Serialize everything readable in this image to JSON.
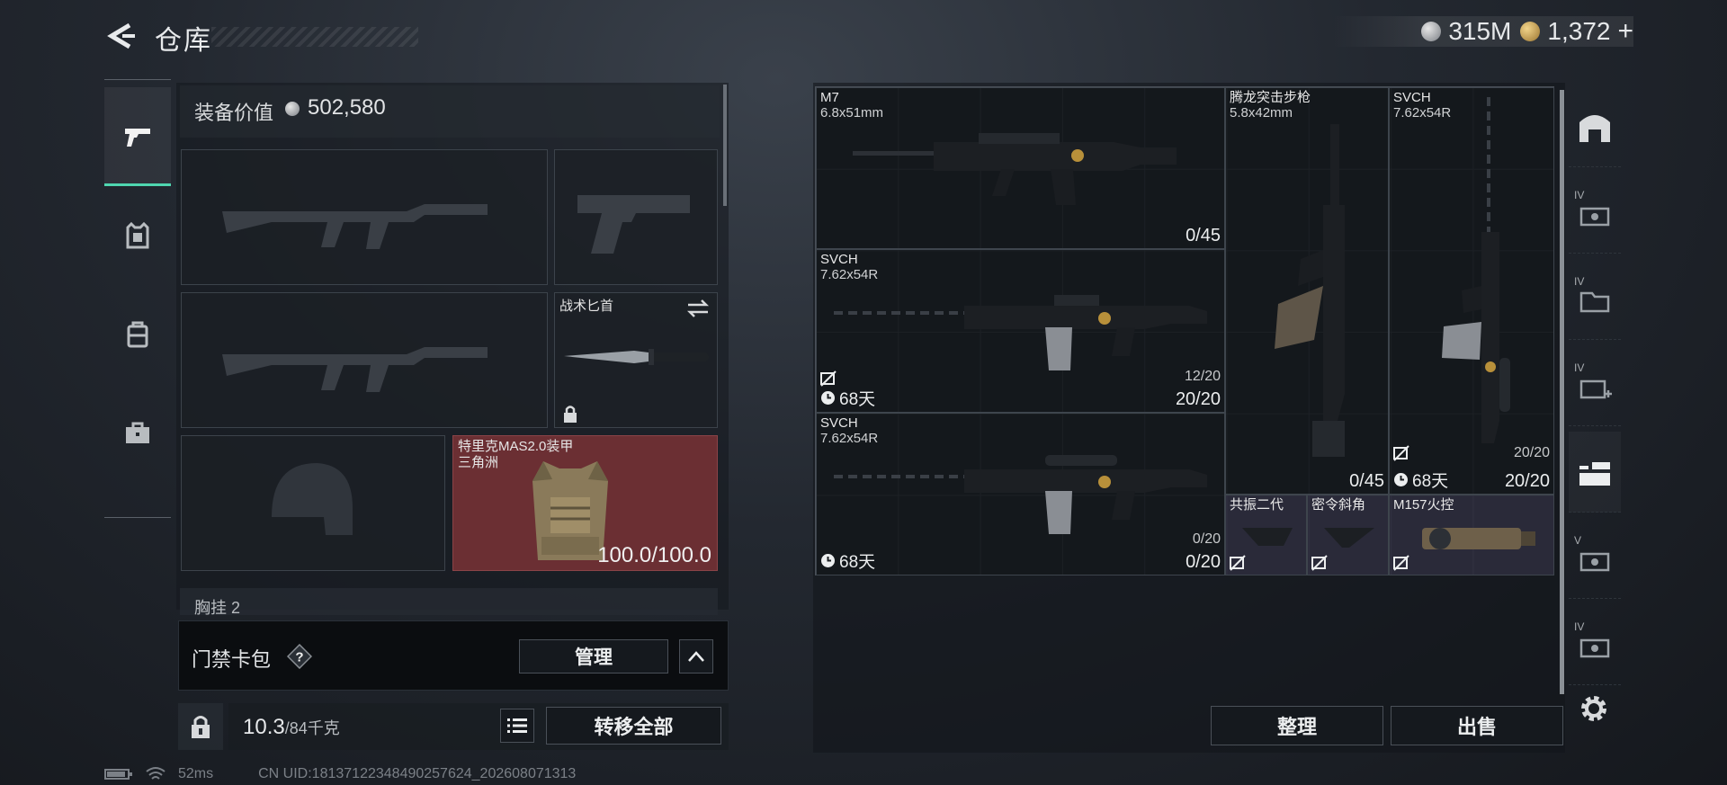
{
  "header": {
    "title": "仓库",
    "silver_amount": "315M",
    "gold_amount": "1,372",
    "gold_plus": "+"
  },
  "equipment": {
    "value_label": "装备价值",
    "value": "502,580",
    "knife_label": "战术匕首",
    "armor_label_line1": "特里克MAS2.0装甲",
    "armor_label_line2": "三角洲",
    "armor_durability": "100.0/100.0",
    "chest_rig_label": "胸挂 2"
  },
  "access_card": {
    "label": "门禁卡包",
    "help": "?",
    "manage_button": "管理"
  },
  "bottom_left": {
    "weight_current": "10.3",
    "weight_max": "/84千克",
    "transfer_all_button": "转移全部"
  },
  "status_bar": {
    "ping": "52ms",
    "uid": "CN UID:1813712234849025762​4_202608071313"
  },
  "storage": {
    "items": [
      {
        "name": "M7",
        "caliber": "6.8x51mm",
        "ammo": "0/45"
      },
      {
        "name": "SVCH",
        "caliber": "7.62x54R",
        "ammo_loaded": "12/20",
        "ammo": "20/20",
        "days": "68天"
      },
      {
        "name": "SVCH",
        "caliber": "7.62x54R",
        "ammo_loaded": "0/20",
        "ammo": "0/20",
        "days": "68天"
      },
      {
        "name": "腾龙突击步枪",
        "caliber": "5.8x42mm",
        "ammo": "0/45"
      },
      {
        "name": "SVCH",
        "caliber": "7.62x54R",
        "ammo_loaded": "20/20",
        "ammo": "20/20",
        "days": "68天"
      },
      {
        "name": "共振二代"
      },
      {
        "name": "密令斜角"
      },
      {
        "name": "M157火控"
      }
    ],
    "sort_button": "整理",
    "sell_button": "出售"
  },
  "right_tabs": [
    "IV",
    "IV",
    "IV",
    "V",
    "IV"
  ],
  "colors": {
    "accent": "#4fd6b0",
    "armor_bg": "#6b2f33",
    "attachment_bg": "#3c3850"
  }
}
